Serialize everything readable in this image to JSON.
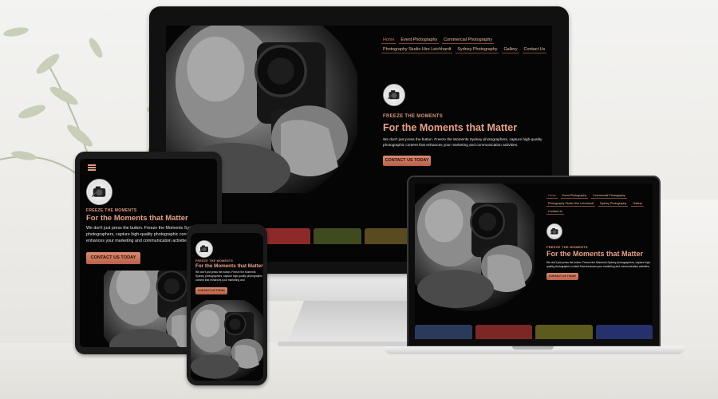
{
  "nav_items": [
    "Home",
    "Event Photography",
    "Commercial Photography",
    "Photography Studio Hire Leichhardt",
    "Sydney Photography",
    "Gallery",
    "Contact Us"
  ],
  "hero": {
    "tagline": "FREEZE THE MOMENTS",
    "headline": "For the Moments that Matter",
    "body": "We don't just press the button. Freeze the Moments Sydney photographers, capture high-quality photographic content that enhances your marketing and communication activities.",
    "cta_label": "CONTACT US TODAY"
  },
  "colors": {
    "accent": "#e7a287",
    "cta": "#c9745a",
    "screen_bg": "#050505"
  },
  "icons": {
    "menu": "hamburger-icon",
    "logo": "camera-logo"
  }
}
